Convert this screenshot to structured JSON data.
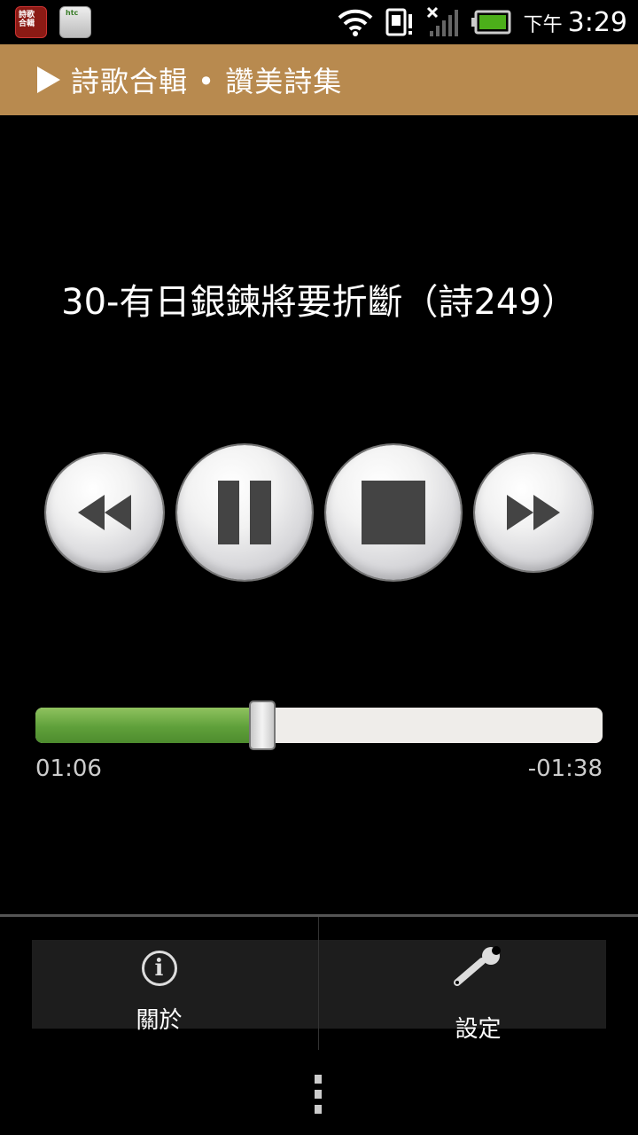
{
  "status_bar": {
    "ampm": "下午",
    "time": "3:29",
    "notification_icons": [
      "hymn-app-icon",
      "htc-tool-icon"
    ],
    "system_icons": [
      "wifi-icon",
      "sim-icon",
      "signal-off-icon",
      "battery-icon"
    ]
  },
  "header": {
    "title": "詩歌合輯 • 讚美詩集",
    "icon": "play-icon",
    "color": "#b88a4f"
  },
  "player": {
    "song_title": "30-有日銀鍊將要折斷（詩249）",
    "controls": [
      "rewind-icon",
      "pause-icon",
      "stop-icon",
      "fast-forward-icon"
    ],
    "progress": 0.4,
    "elapsed": "01:06",
    "remaining": "-01:38",
    "progress_color": "#5fa03a"
  },
  "menu": {
    "items": [
      {
        "label": "關於",
        "icon": "info-icon"
      },
      {
        "label": "設定",
        "icon": "wrench-icon"
      }
    ]
  }
}
